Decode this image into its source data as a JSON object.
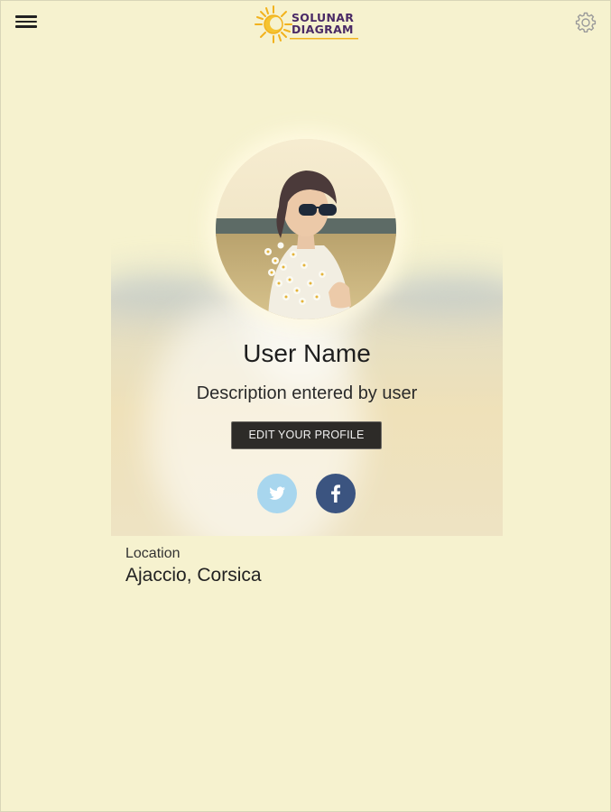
{
  "header": {
    "logo_line1": "SOLUNAR",
    "logo_line2": "DIAGRAM",
    "menu_icon": "hamburger-menu-icon",
    "settings_icon": "gear-icon"
  },
  "profile": {
    "name": "User Name",
    "description": "Description entered by user",
    "edit_button_label": "EDIT YOUR PROFILE",
    "social": [
      {
        "network": "twitter",
        "icon": "twitter-icon",
        "color": "#a8d6ee"
      },
      {
        "network": "facebook",
        "icon": "facebook-icon",
        "color": "#3b5480"
      }
    ]
  },
  "location": {
    "label": "Location",
    "value": "Ajaccio, Corsica"
  },
  "colors": {
    "background": "#f6f2cf",
    "logo_text": "#4a2a66",
    "logo_sun": "#f2b21d",
    "button": "#2d2b28"
  }
}
